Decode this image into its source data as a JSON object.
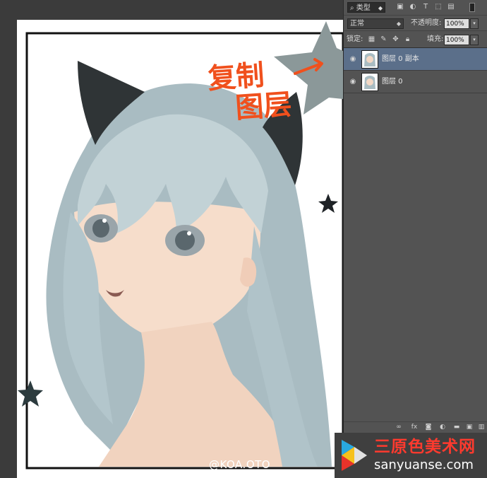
{
  "canvas": {
    "annotation_line1": "复制",
    "annotation_line2": "图层",
    "watermark": "@KOA.OTO"
  },
  "layers_panel": {
    "filter_kind": "类型",
    "blend_mode": "正常",
    "opacity_label": "不透明度:",
    "opacity_value": "100%",
    "lock_label": "锁定:",
    "fill_label": "填充:",
    "fill_value": "100%",
    "layers": [
      {
        "name": "图层 0 副本",
        "selected": true,
        "visible": true
      },
      {
        "name": "图层 0",
        "selected": false,
        "visible": true
      }
    ]
  },
  "logo": {
    "cn": "三原色美术网",
    "en": "sanyuanse.com"
  },
  "colors": {
    "selected_layer": "#5b6f8a",
    "panel_bg": "#535353",
    "annotation": "#f0501d",
    "logo_red": "#ff3a2e"
  }
}
